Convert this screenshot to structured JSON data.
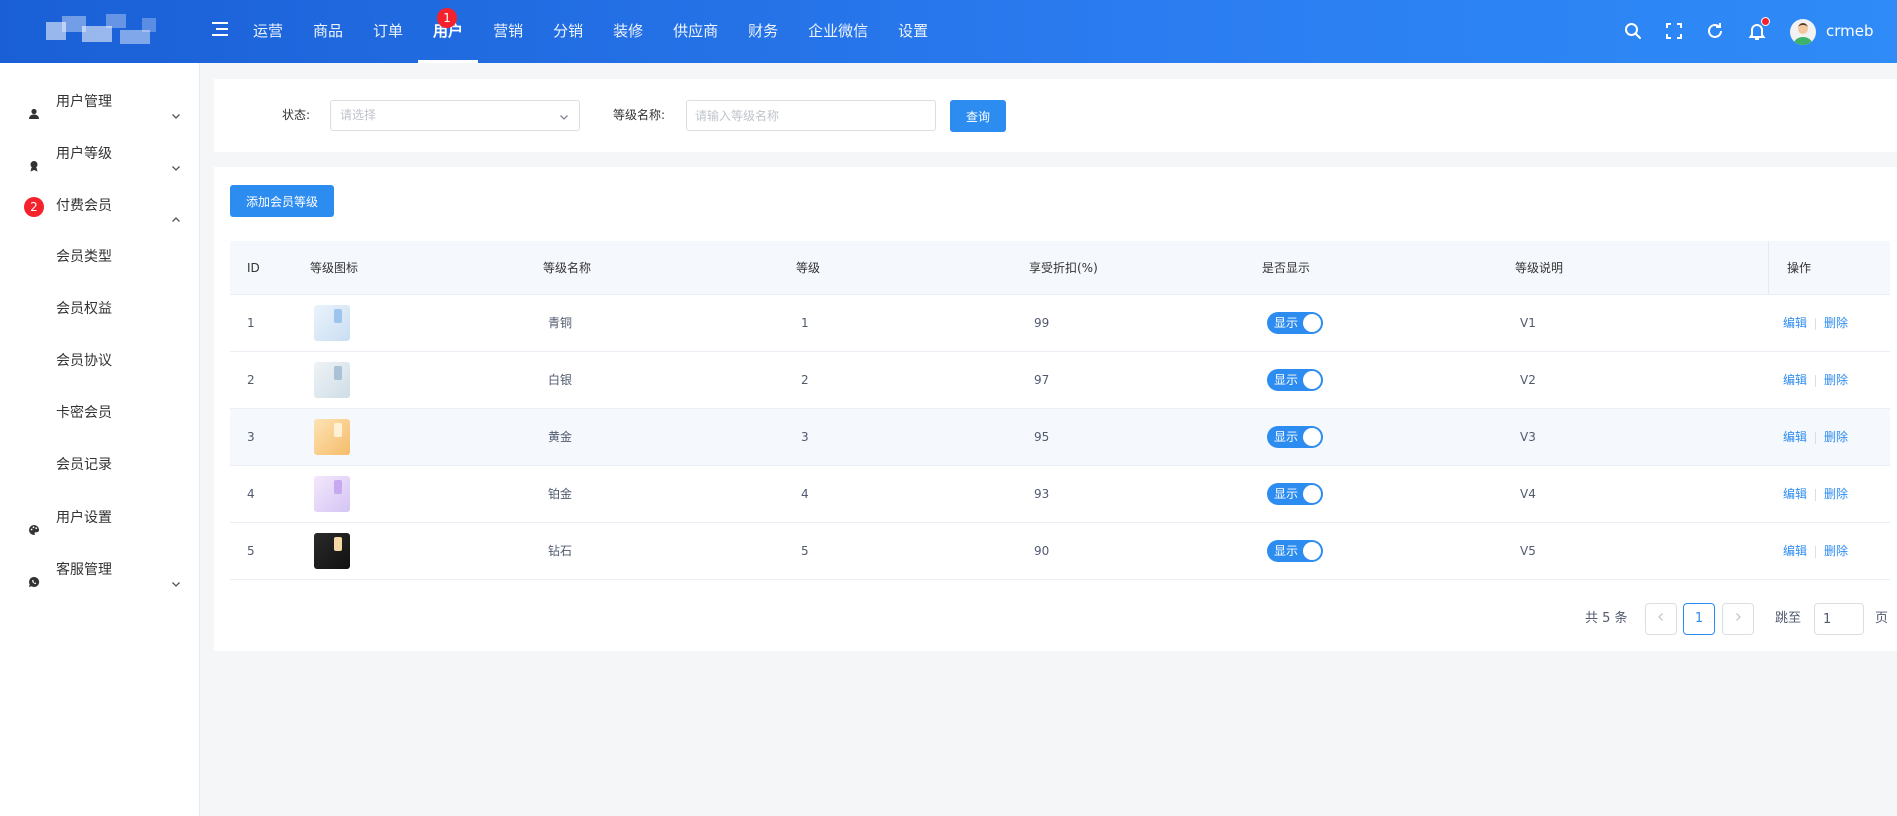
{
  "header": {
    "nav": [
      {
        "label": "运营",
        "active": false
      },
      {
        "label": "商品",
        "active": false
      },
      {
        "label": "订单",
        "active": false
      },
      {
        "label": "用户",
        "active": true,
        "badge": "1"
      },
      {
        "label": "营销",
        "active": false
      },
      {
        "label": "分销",
        "active": false
      },
      {
        "label": "装修",
        "active": false
      },
      {
        "label": "供应商",
        "active": false
      },
      {
        "label": "财务",
        "active": false
      },
      {
        "label": "企业微信",
        "active": false
      },
      {
        "label": "设置",
        "active": false
      }
    ],
    "username": "crmeb"
  },
  "sidebar": {
    "items": [
      {
        "label": "用户管理",
        "icon": "user-icon",
        "expanded": false
      },
      {
        "label": "用户等级",
        "icon": "level-icon",
        "expanded": false
      },
      {
        "label": "付费会员",
        "icon": "",
        "badge": "2",
        "expanded": true,
        "children": [
          "会员类型",
          "会员权益",
          "会员协议",
          "卡密会员",
          "会员记录"
        ]
      },
      {
        "label": "用户设置",
        "icon": "palette-icon"
      },
      {
        "label": "客服管理",
        "icon": "chat-icon",
        "expanded": false
      }
    ]
  },
  "filter": {
    "status_label": "状态:",
    "status_placeholder": "请选择",
    "name_label": "等级名称:",
    "name_placeholder": "请输入等级名称",
    "query_button": "查询"
  },
  "toolbar": {
    "add_button": "添加会员等级"
  },
  "table": {
    "columns": [
      "ID",
      "等级图标",
      "等级名称",
      "等级",
      "享受折扣(%)",
      "是否显示",
      "等级说明",
      "操作"
    ],
    "rows": [
      {
        "id": "1",
        "icon": "bronze",
        "name": "青铜",
        "level": "1",
        "discount": "99",
        "show": "显示",
        "desc": "V1",
        "edit": "编辑",
        "delete": "删除"
      },
      {
        "id": "2",
        "icon": "silver",
        "name": "白银",
        "level": "2",
        "discount": "97",
        "show": "显示",
        "desc": "V2",
        "edit": "编辑",
        "delete": "删除"
      },
      {
        "id": "3",
        "icon": "gold",
        "name": "黄金",
        "level": "3",
        "discount": "95",
        "show": "显示",
        "desc": "V3",
        "edit": "编辑",
        "delete": "删除"
      },
      {
        "id": "4",
        "icon": "platinum",
        "name": "铂金",
        "level": "4",
        "discount": "93",
        "show": "显示",
        "desc": "V4",
        "edit": "编辑",
        "delete": "删除"
      },
      {
        "id": "5",
        "icon": "diamond",
        "name": "钻石",
        "level": "5",
        "discount": "90",
        "show": "显示",
        "desc": "V5",
        "edit": "编辑",
        "delete": "删除"
      }
    ]
  },
  "pagination": {
    "total_text": "共 5 条",
    "current_page": "1",
    "jump_label": "跳至",
    "jump_value": "1",
    "page_suffix": "页"
  },
  "colors": {
    "primary": "#2d8cf0",
    "badge": "#f5222d",
    "header_start": "#1a5fd6",
    "header_end": "#2e8bf7"
  }
}
